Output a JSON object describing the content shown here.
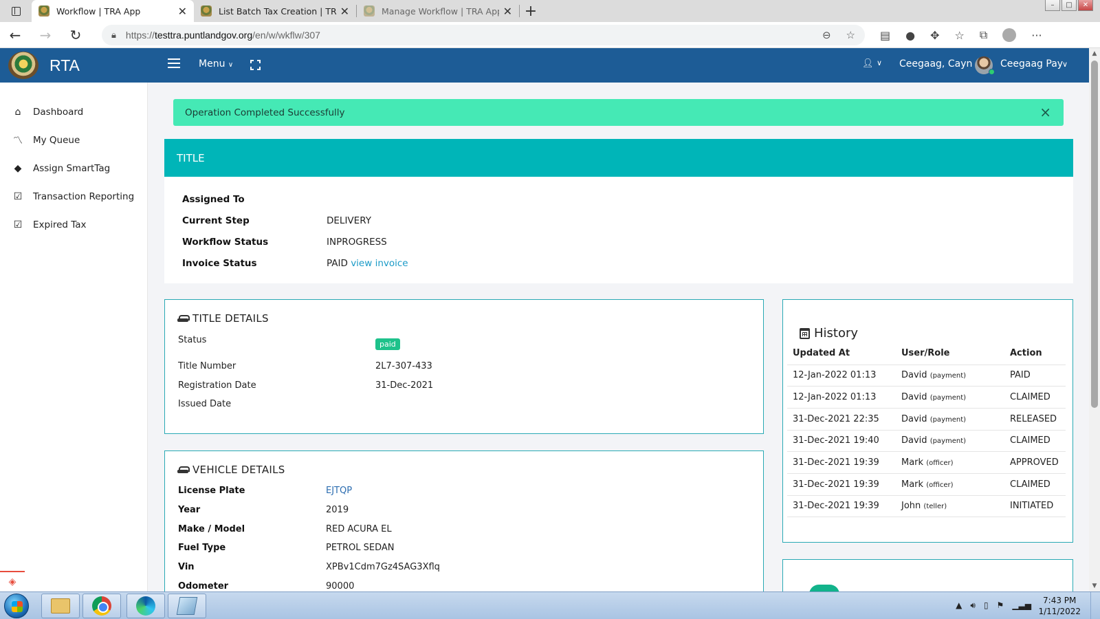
{
  "browser": {
    "tabs": [
      {
        "title": "Workflow | TRA App",
        "active": true
      },
      {
        "title": "List Batch Tax Creation | TRA App",
        "active": false
      },
      {
        "title": "Manage Workflow | TRA App",
        "active": false
      }
    ],
    "url_prefix": "https://",
    "url_host": "testtra.puntlandgov.org",
    "url_path": "/en/w/wkflw/307",
    "close_glyph": "✕",
    "new_tab_glyph": "+"
  },
  "app": {
    "brand": "RTA",
    "menu_label": "Menu",
    "user_name": "Ceegaag, Cayn",
    "profile_name": "Ceegaag Pay",
    "colors": {
      "header": "#1d5c96",
      "accent": "#00b5b8",
      "alert": "#45e9b5",
      "badge": "#1ec28b"
    }
  },
  "sidebar": {
    "items": [
      {
        "label": "Dashboard",
        "icon": "home-icon"
      },
      {
        "label": "My Queue",
        "icon": "line-chart-icon"
      },
      {
        "label": "Assign SmartTag",
        "icon": "tags-icon"
      },
      {
        "label": "Transaction Reporting",
        "icon": "check-square-icon"
      },
      {
        "label": "Expired Tax",
        "icon": "check-square-icon"
      }
    ]
  },
  "alert": {
    "message": "Operation Completed Successfully",
    "close": "×"
  },
  "title_card": {
    "header": "TITLE",
    "assigned_to_label": "Assigned To",
    "assigned_to_value": "",
    "current_step_label": "Current Step",
    "current_step_value": "DELIVERY",
    "workflow_status_label": "Workflow Status",
    "workflow_status_value": "INPROGRESS",
    "invoice_status_label": "Invoice Status",
    "invoice_status_value": "PAID",
    "invoice_link": "view invoice"
  },
  "title_details": {
    "heading": "TITLE DETAILS",
    "status_label": "Status",
    "status_badge": "paid",
    "title_number_label": "Title Number",
    "title_number_value": "2L7-307-433",
    "registration_date_label": "Registration Date",
    "registration_date_value": "31-Dec-2021",
    "issued_date_label": "Issued Date",
    "issued_date_value": ""
  },
  "vehicle_details": {
    "heading": "VEHICLE DETAILS",
    "rows": [
      {
        "label": "License Plate",
        "value": "EJTQP"
      },
      {
        "label": "Year",
        "value": "2019"
      },
      {
        "label": "Make / Model",
        "value": "RED ACURA EL"
      },
      {
        "label": "Fuel Type",
        "value": "PETROL SEDAN"
      },
      {
        "label": "Vin",
        "value": "XPBv1Cdm7Gz4SAG3Xflq"
      },
      {
        "label": "Odometer",
        "value": "90000"
      }
    ]
  },
  "history": {
    "heading": "History",
    "columns": [
      "Updated At",
      "User/Role",
      "Action"
    ],
    "rows": [
      {
        "updated_at": "12-Jan-2022 01:13",
        "user": "David",
        "role": "(payment)",
        "action": "PAID"
      },
      {
        "updated_at": "12-Jan-2022 01:13",
        "user": "David",
        "role": "(payment)",
        "action": "CLAIMED"
      },
      {
        "updated_at": "31-Dec-2021 22:35",
        "user": "David",
        "role": "(payment)",
        "action": "RELEASED"
      },
      {
        "updated_at": "31-Dec-2021 19:40",
        "user": "David",
        "role": "(payment)",
        "action": "CLAIMED"
      },
      {
        "updated_at": "31-Dec-2021 19:39",
        "user": "Mark",
        "role": "(officer)",
        "action": "APPROVED"
      },
      {
        "updated_at": "31-Dec-2021 19:39",
        "user": "Mark",
        "role": "(officer)",
        "action": "CLAIMED"
      },
      {
        "updated_at": "31-Dec-2021 19:39",
        "user": "John",
        "role": "(teller)",
        "action": "INITIATED"
      }
    ]
  },
  "taskbar": {
    "time": "7:43 PM",
    "date": "1/11/2022"
  }
}
